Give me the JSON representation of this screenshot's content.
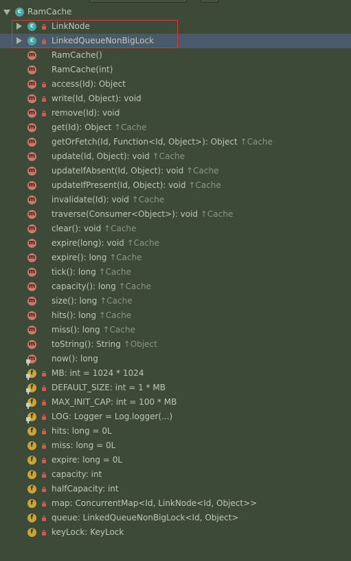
{
  "tree": {
    "root": {
      "label": "RamCache",
      "icon": "class-icon",
      "kind": "c"
    },
    "children": [
      {
        "label": "LinkNode",
        "kind": "c",
        "lock": true,
        "expandable": true
      },
      {
        "label": "LinkedQueueNonBigLock",
        "kind": "c",
        "lock": true,
        "expandable": true,
        "selected": true
      },
      {
        "label": "RamCache()",
        "kind": "m"
      },
      {
        "label": "RamCache(int)",
        "kind": "m"
      },
      {
        "label": "access(Id): Object",
        "kind": "m",
        "lock": true
      },
      {
        "label": "write(Id, Object): void",
        "kind": "m",
        "lock": true
      },
      {
        "label": "remove(Id): void",
        "kind": "m",
        "lock": true
      },
      {
        "label": "get(Id): Object",
        "kind": "m",
        "inherit": "↑Cache"
      },
      {
        "label": "getOrFetch(Id, Function<Id, Object>): Object",
        "kind": "m",
        "inherit": "↑Cache"
      },
      {
        "label": "update(Id, Object): void",
        "kind": "m",
        "inherit": "↑Cache"
      },
      {
        "label": "updateIfAbsent(Id, Object): void",
        "kind": "m",
        "inherit": "↑Cache"
      },
      {
        "label": "updateIfPresent(Id, Object): void",
        "kind": "m",
        "inherit": "↑Cache"
      },
      {
        "label": "invalidate(Id): void",
        "kind": "m",
        "inherit": "↑Cache"
      },
      {
        "label": "traverse(Consumer<Object>): void",
        "kind": "m",
        "inherit": "↑Cache"
      },
      {
        "label": "clear(): void",
        "kind": "m",
        "inherit": "↑Cache"
      },
      {
        "label": "expire(long): void",
        "kind": "m",
        "inherit": "↑Cache"
      },
      {
        "label": "expire(): long",
        "kind": "m",
        "inherit": "↑Cache"
      },
      {
        "label": "tick(): long",
        "kind": "m",
        "inherit": "↑Cache"
      },
      {
        "label": "capacity(): long",
        "kind": "m",
        "inherit": "↑Cache"
      },
      {
        "label": "size(): long",
        "kind": "m",
        "inherit": "↑Cache"
      },
      {
        "label": "hits(): long",
        "kind": "m",
        "inherit": "↑Cache"
      },
      {
        "label": "miss(): long",
        "kind": "m",
        "inherit": "↑Cache"
      },
      {
        "label": "toString(): String",
        "kind": "m",
        "inherit": "↑Object"
      },
      {
        "label": "now(): long",
        "kind": "m",
        "pin": true
      },
      {
        "label": "MB: int = 1024 * 1024",
        "kind": "f",
        "pin": true,
        "lock": true
      },
      {
        "label": "DEFAULT_SIZE: int = 1 * MB",
        "kind": "f",
        "pin": true,
        "lock": true
      },
      {
        "label": "MAX_INIT_CAP: int = 100 * MB",
        "kind": "f",
        "pin": true,
        "lock": true
      },
      {
        "label": "LOG: Logger = Log.logger(...)",
        "kind": "f",
        "pin": true,
        "lock": true
      },
      {
        "label": "hits: long = 0L",
        "kind": "f",
        "lock": true
      },
      {
        "label": "miss: long = 0L",
        "kind": "f",
        "lock": true
      },
      {
        "label": "expire: long = 0L",
        "kind": "f",
        "lock": true
      },
      {
        "label": "capacity: int",
        "kind": "f",
        "lock": true
      },
      {
        "label": "halfCapacity: int",
        "kind": "f",
        "lock": true
      },
      {
        "label": "map: ConcurrentMap<Id, LinkNode<Id, Object>>",
        "kind": "f",
        "lock": true
      },
      {
        "label": "queue: LinkedQueueNonBigLock<Id, Object>",
        "kind": "f",
        "lock": true
      },
      {
        "label": "keyLock: KeyLock",
        "kind": "f",
        "lock": true
      }
    ]
  },
  "colors": {
    "background": "#3c4a37",
    "selection": "#4a5a6b",
    "highlight_border": "#d33b3b",
    "text": "#bfc7b7",
    "inherit_text": "#8b9683"
  }
}
